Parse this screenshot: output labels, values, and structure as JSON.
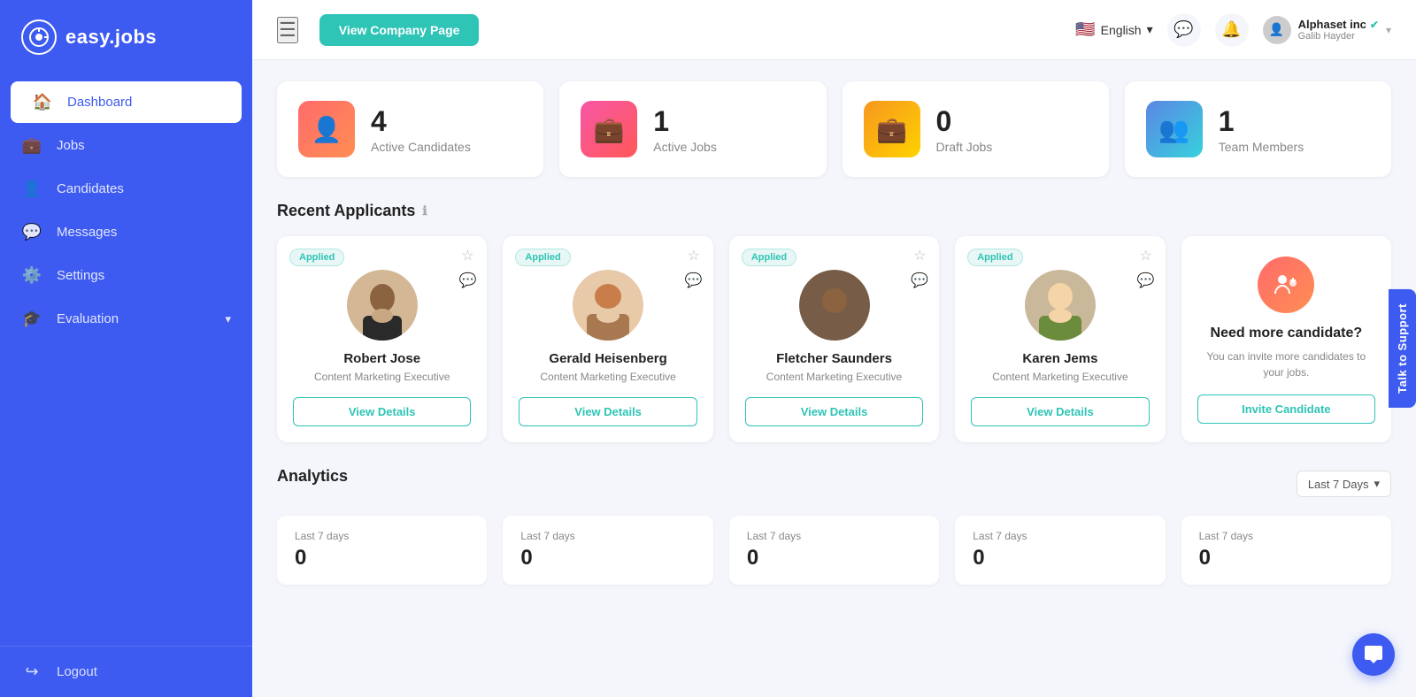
{
  "app": {
    "name": "easy.jobs"
  },
  "sidebar": {
    "logo_text": "easy.jobs",
    "items": [
      {
        "id": "dashboard",
        "label": "Dashboard",
        "icon": "🏠",
        "active": true
      },
      {
        "id": "jobs",
        "label": "Jobs",
        "icon": "💼",
        "active": false
      },
      {
        "id": "candidates",
        "label": "Candidates",
        "icon": "👤",
        "active": false
      },
      {
        "id": "messages",
        "label": "Messages",
        "icon": "💬",
        "active": false
      },
      {
        "id": "settings",
        "label": "Settings",
        "icon": "⚙️",
        "active": false
      },
      {
        "id": "evaluation",
        "label": "Evaluation",
        "icon": "🎓",
        "active": false,
        "has_arrow": true
      }
    ],
    "logout_label": "Logout"
  },
  "header": {
    "view_company_btn": "View Company Page",
    "language": "English",
    "user": {
      "company": "Alphaset inc",
      "name": "Galib Hayder",
      "verified": true
    }
  },
  "stats": [
    {
      "id": "active-candidates",
      "count": "4",
      "label": "Active Candidates",
      "icon_type": "red-grad",
      "icon": "👤"
    },
    {
      "id": "active-jobs",
      "count": "1",
      "label": "Active Jobs",
      "icon_type": "pink-grad",
      "icon": "💼"
    },
    {
      "id": "draft-jobs",
      "count": "0",
      "label": "Draft Jobs",
      "icon_type": "orange-grad",
      "icon": "💼"
    },
    {
      "id": "team-members",
      "count": "1",
      "label": "Team Members",
      "icon_type": "blue-grad",
      "icon": "👥"
    }
  ],
  "recent_applicants": {
    "title": "Recent Applicants",
    "applied_badge": "Applied",
    "view_details_btn": "View Details",
    "applicants": [
      {
        "id": 1,
        "name": "Robert Jose",
        "role": "Content Marketing Executive",
        "avatar_color": "#c8a882"
      },
      {
        "id": 2,
        "name": "Gerald Heisenberg",
        "role": "Content Marketing Executive",
        "avatar_color": "#d4956e"
      },
      {
        "id": 3,
        "name": "Fletcher Saunders",
        "role": "Content Marketing Executive",
        "avatar_color": "#8b7355"
      },
      {
        "id": 4,
        "name": "Karen Jems",
        "role": "Content Marketing Executive",
        "avatar_color": "#c9b89a"
      }
    ],
    "invite": {
      "title": "Need more candidate?",
      "description": "You can invite more candidates to your jobs.",
      "btn_label": "Invite Candidate"
    }
  },
  "analytics": {
    "title": "Analytics",
    "filter_label": "Last 7 Days",
    "cards": [
      {
        "label": "Last 7 days",
        "count": "0"
      },
      {
        "label": "Last 7 days",
        "count": "0"
      },
      {
        "label": "Last 7 days",
        "count": "0"
      },
      {
        "label": "Last 7 days",
        "count": "0"
      },
      {
        "label": "Last 7 days",
        "count": "0"
      }
    ]
  },
  "support": {
    "label": "Talk to Support"
  },
  "chat": {
    "icon": "💬"
  }
}
